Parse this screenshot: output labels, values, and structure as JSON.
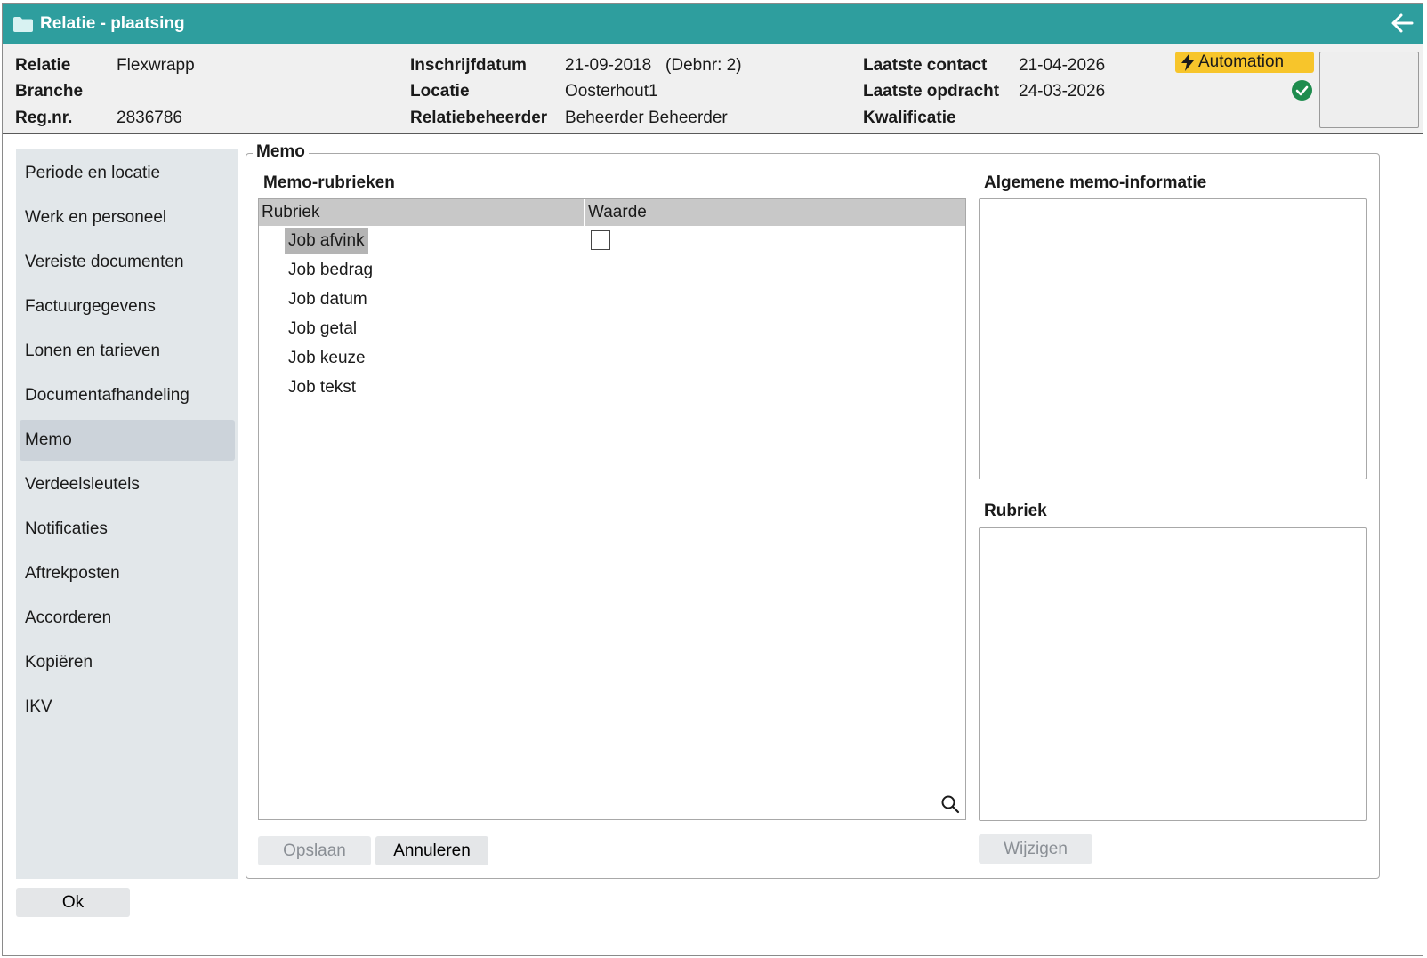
{
  "window": {
    "title": "Relatie - plaatsing"
  },
  "header": {
    "relatie_label": "Relatie",
    "relatie_value": "Flexwrapp",
    "branche_label": "Branche",
    "branche_value": "",
    "regnr_label": "Reg.nr.",
    "regnr_value": "2836786",
    "inschrijfdatum_label": "Inschrijfdatum",
    "inschrijfdatum_value": "21-09-2018   (Debnr: 2)",
    "locatie_label": "Locatie",
    "locatie_value": "Oosterhout1",
    "relatiebeheerder_label": "Relatiebeheerder",
    "relatiebeheerder_value": "Beheerder Beheerder",
    "laatste_contact_label": "Laatste contact",
    "laatste_contact_value": "21-04-2026",
    "laatste_opdracht_label": "Laatste opdracht",
    "laatste_opdracht_value": "24-03-2026",
    "kwalificatie_label": "Kwalificatie",
    "kwalificatie_value": "",
    "automation_label": "Automation"
  },
  "sidebar": {
    "items": [
      {
        "label": "Periode en locatie"
      },
      {
        "label": "Werk en personeel"
      },
      {
        "label": "Vereiste documenten"
      },
      {
        "label": "Factuurgegevens"
      },
      {
        "label": "Lonen en tarieven"
      },
      {
        "label": "Documentafhandeling"
      },
      {
        "label": "Memo"
      },
      {
        "label": "Verdeelsleutels"
      },
      {
        "label": "Notificaties"
      },
      {
        "label": "Aftrekposten"
      },
      {
        "label": "Accorderen"
      },
      {
        "label": "Kopiëren"
      },
      {
        "label": "IKV"
      }
    ],
    "active_index": 6
  },
  "memo": {
    "group_title": "Memo",
    "rubrieken_title": "Memo-rubrieken",
    "columns": [
      "Rubriek",
      "Waarde"
    ],
    "rows": [
      {
        "rubriek": "Job afvink",
        "has_checkbox": true,
        "checked": false
      },
      {
        "rubriek": "Job bedrag"
      },
      {
        "rubriek": "Job datum"
      },
      {
        "rubriek": "Job getal"
      },
      {
        "rubriek": "Job keuze"
      },
      {
        "rubriek": "Job tekst"
      }
    ],
    "selected_row": 0,
    "algemeen_title": "Algemene memo-informatie",
    "algemeen_value": "",
    "rubriek_title": "Rubriek",
    "rubriek_value": "",
    "opslaan_label": "Opslaan",
    "annuleren_label": "Annuleren",
    "wijzigen_label": "Wijzigen"
  },
  "footer": {
    "ok_label": "Ok"
  },
  "colors": {
    "titlebar": "#2e9e9e",
    "automation": "#f7c52b",
    "check": "#1e8c4e"
  }
}
